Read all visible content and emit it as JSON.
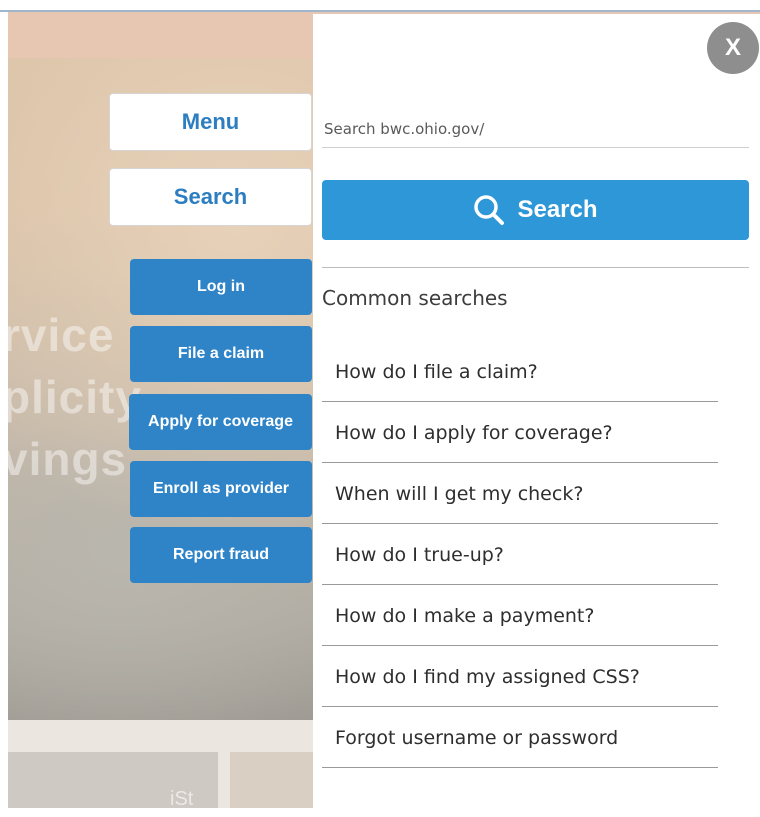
{
  "left_tabs": {
    "menu_label": "Menu",
    "search_label": "Search"
  },
  "quick_links": [
    {
      "label": "Log in"
    },
    {
      "label": "File a claim"
    },
    {
      "label": "Apply for coverage"
    },
    {
      "label": "Enroll as provider"
    },
    {
      "label": "Report fraud"
    }
  ],
  "background": {
    "hero_lines": [
      "rvice",
      "plicity",
      "vings"
    ],
    "watermark": "iSt"
  },
  "search_panel": {
    "close_label": "X",
    "input_placeholder": "Search bwc.ohio.gov/",
    "input_value": "",
    "search_button_label": "Search",
    "search_icon": "search-icon",
    "common_searches_title": "Common searches",
    "common_searches": [
      "How do I file a claim?",
      "How do I apply for coverage?",
      "When will I get my check?",
      "How do I true-up?",
      "How do I make a payment?",
      "How do I find my assigned CSS?",
      "Forgot username or password"
    ]
  },
  "colors": {
    "accent_blue": "#2d97d7",
    "button_blue": "#2f84c8",
    "tab_text_blue": "#2c7ec1",
    "close_gray": "#8e8e8e"
  }
}
